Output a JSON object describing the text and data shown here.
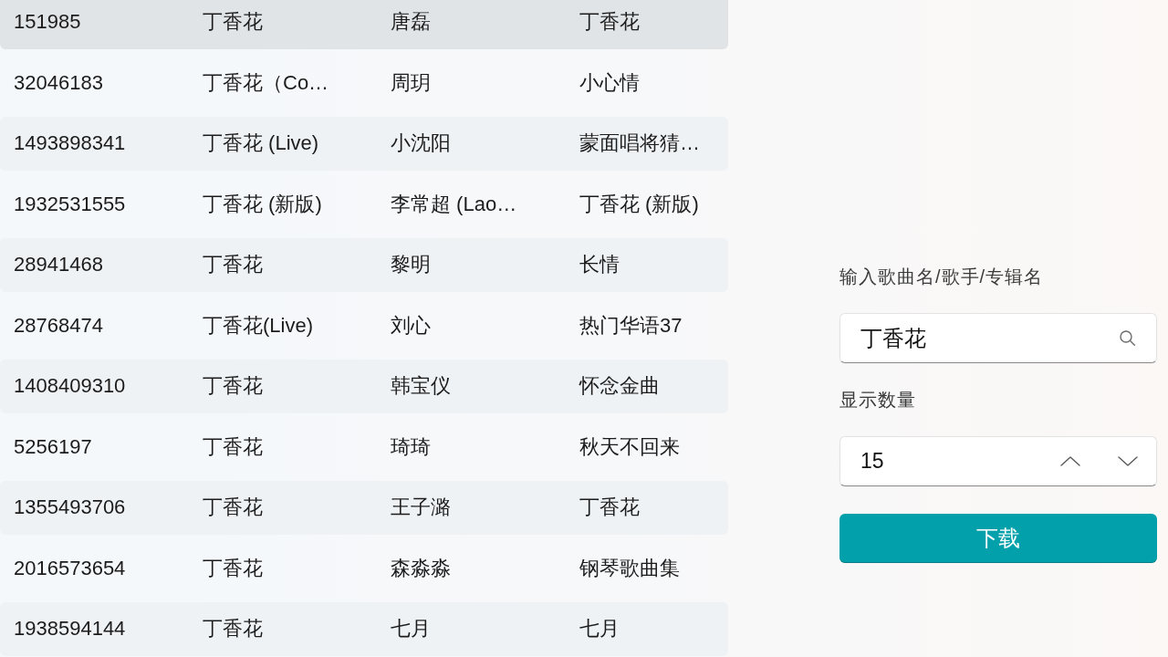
{
  "results": {
    "rows": [
      {
        "cells": [
          "151985",
          "丁香花",
          "唐磊",
          "丁香花"
        ],
        "selected": true
      },
      {
        "cells": [
          "32046183",
          "丁香花（Co…",
          "周玥",
          "小心情"
        ],
        "selected": false
      },
      {
        "cells": [
          "1493898341",
          "丁香花 (Live)",
          "小沈阳",
          "蒙面唱将猜…"
        ],
        "selected": false
      },
      {
        "cells": [
          "1932531555",
          "丁香花 (新版)",
          "李常超 (Lao…",
          "丁香花 (新版)"
        ],
        "selected": false
      },
      {
        "cells": [
          "28941468",
          "丁香花",
          "黎明",
          "长情"
        ],
        "selected": false
      },
      {
        "cells": [
          "28768474",
          "丁香花(Live)",
          "刘心",
          "热门华语37"
        ],
        "selected": false
      },
      {
        "cells": [
          "1408409310",
          "丁香花",
          "韩宝仪",
          "怀念金曲"
        ],
        "selected": false
      },
      {
        "cells": [
          "5256197",
          "丁香花",
          "琦琦",
          "秋天不回来"
        ],
        "selected": false
      },
      {
        "cells": [
          "1355493706",
          "丁香花",
          "王子潞",
          "丁香花"
        ],
        "selected": false
      },
      {
        "cells": [
          "2016573654",
          "丁香花",
          "森淼淼",
          "钢琴歌曲集"
        ],
        "selected": false
      },
      {
        "cells": [
          "1938594144",
          "丁香花",
          "七月",
          "七月"
        ],
        "selected": false
      }
    ]
  },
  "search": {
    "label": "输入歌曲名/歌手/专辑名",
    "value": "丁香花"
  },
  "count": {
    "label": "显示数量",
    "value": "15"
  },
  "download_button": {
    "label": "下载"
  }
}
